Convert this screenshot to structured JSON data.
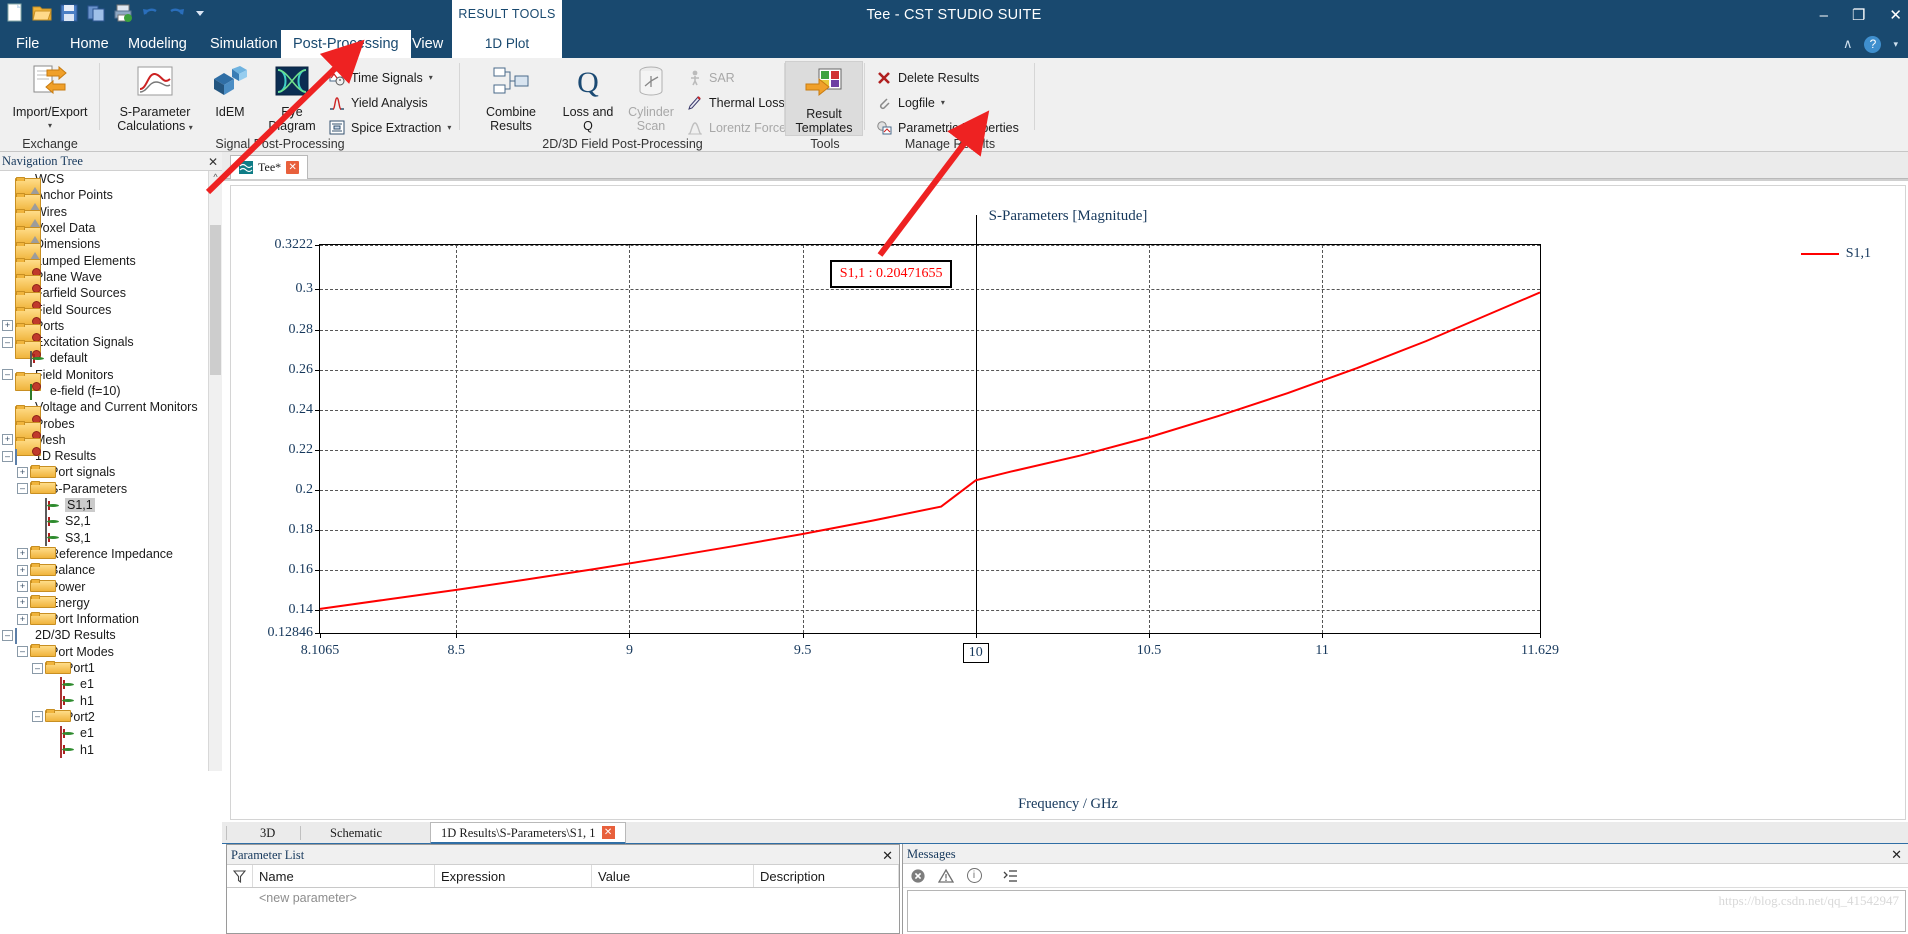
{
  "window": {
    "title": "Tee - CST STUDIO SUITE",
    "minimize": "–",
    "maximize": "❐",
    "close": "✕"
  },
  "quick_access": [
    "new-icon",
    "open-icon",
    "save-icon",
    "copy-icon",
    "print-icon",
    "undo-icon",
    "redo-icon",
    "customize-icon"
  ],
  "context_tab": {
    "line1": "RESULT TOOLS",
    "line2": "1D Plot"
  },
  "tabs": [
    {
      "label": "File",
      "active": false
    },
    {
      "label": "Home",
      "active": false
    },
    {
      "label": "Modeling",
      "active": false
    },
    {
      "label": "Simulation",
      "active": false
    },
    {
      "label": "Post-Processing",
      "active": true
    },
    {
      "label": "View",
      "active": false
    }
  ],
  "help": {
    "collapse": "∧",
    "question": "?",
    "caret": "▾"
  },
  "ribbon": {
    "groups": [
      {
        "label": "Exchange"
      },
      {
        "label": "Signal Post-Processing"
      },
      {
        "label": "2D/3D Field Post-Processing"
      },
      {
        "label": "Tools"
      },
      {
        "label": "Manage Results"
      }
    ],
    "big_buttons": [
      {
        "name": "import-export",
        "line1": "Import/Export",
        "line2": "",
        "caret": "▾",
        "icon": "import-export-icon"
      },
      {
        "name": "s-parameter-calculations",
        "line1": "S-Parameter",
        "line2": "Calculations",
        "caret": "▾",
        "icon": "s-parameter-icon"
      },
      {
        "name": "ideem",
        "line1": "IdEM",
        "line2": "",
        "caret": "",
        "icon": "idem-icon"
      },
      {
        "name": "eye-diagram",
        "line1": "Eye",
        "line2": "Diagram",
        "caret": "",
        "icon": "eye-diagram-icon"
      },
      {
        "name": "combine-results",
        "line1": "Combine",
        "line2": "Results",
        "caret": "",
        "icon": "combine-results-icon"
      },
      {
        "name": "loss-and-q",
        "line1": "Loss and",
        "line2": "Q",
        "caret": "",
        "icon": "loss-q-icon"
      },
      {
        "name": "cylinder-scan",
        "line1": "Cylinder",
        "line2": "Scan",
        "caret": "",
        "icon": "cylinder-scan-icon",
        "disabled": true
      },
      {
        "name": "result-templates",
        "line1": "Result",
        "line2": "Templates",
        "caret": "",
        "icon": "result-templates-icon",
        "pressed": true
      }
    ],
    "small_buttons": [
      {
        "name": "time-signals",
        "label": "Time Signals",
        "caret": "▾",
        "icon": "time-signals-icon",
        "disabled": false
      },
      {
        "name": "yield-analysis",
        "label": "Yield Analysis",
        "caret": "",
        "icon": "yield-analysis-icon",
        "disabled": false
      },
      {
        "name": "spice-extraction",
        "label": "Spice Extraction",
        "caret": "▾",
        "icon": "spice-extraction-icon",
        "disabled": false
      },
      {
        "name": "sar",
        "label": "SAR",
        "caret": "",
        "icon": "sar-icon",
        "disabled": true
      },
      {
        "name": "thermal-losses",
        "label": "Thermal Losses",
        "caret": "",
        "icon": "thermal-losses-icon",
        "disabled": false
      },
      {
        "name": "lorentz-forces",
        "label": "Lorentz Forces",
        "caret": "",
        "icon": "lorentz-forces-icon",
        "disabled": true
      },
      {
        "name": "delete-results",
        "label": "Delete Results",
        "caret": "",
        "icon": "delete-results-icon",
        "disabled": false
      },
      {
        "name": "logfile",
        "label": "Logfile",
        "caret": "▾",
        "icon": "logfile-icon",
        "disabled": false
      },
      {
        "name": "parametric-properties",
        "label": "Parametric Properties",
        "caret": "",
        "icon": "parametric-properties-icon",
        "disabled": false
      }
    ]
  },
  "navigation": {
    "header": "Navigation Tree",
    "close": "✕",
    "items": [
      {
        "label": "WCS",
        "indent": 1,
        "expander": "",
        "icon": "folder-shape-icon"
      },
      {
        "label": "Anchor Points",
        "indent": 1,
        "expander": "",
        "icon": "folder-shape-icon"
      },
      {
        "label": "Wires",
        "indent": 1,
        "expander": "",
        "icon": "folder-shape-icon"
      },
      {
        "label": "Voxel Data",
        "indent": 1,
        "expander": "",
        "icon": "folder-shape-icon"
      },
      {
        "label": "Dimensions",
        "indent": 1,
        "expander": "",
        "icon": "folder-shape-icon"
      },
      {
        "label": "Lumped Elements",
        "indent": 1,
        "expander": "",
        "icon": "folder-gear-icon"
      },
      {
        "label": "Plane Wave",
        "indent": 1,
        "expander": "",
        "icon": "folder-gear-icon"
      },
      {
        "label": "Farfield Sources",
        "indent": 1,
        "expander": "",
        "icon": "folder-gear-icon"
      },
      {
        "label": "Field Sources",
        "indent": 1,
        "expander": "",
        "icon": "folder-gear-icon"
      },
      {
        "label": "Ports",
        "indent": 1,
        "expander": "+",
        "icon": "folder-gear-icon"
      },
      {
        "label": "Excitation Signals",
        "indent": 1,
        "expander": "–",
        "icon": "folder-gear-icon"
      },
      {
        "label": "default",
        "indent": 2,
        "expander": "",
        "icon": "signal-icon"
      },
      {
        "label": "Field Monitors",
        "indent": 1,
        "expander": "–",
        "icon": "folder-gear-icon"
      },
      {
        "label": "e-field (f=10)",
        "indent": 2,
        "expander": "",
        "icon": "efield-icon"
      },
      {
        "label": "Voltage and Current Monitors",
        "indent": 1,
        "expander": "",
        "icon": "folder-gear-icon"
      },
      {
        "label": "Probes",
        "indent": 1,
        "expander": "",
        "icon": "folder-gear-icon"
      },
      {
        "label": "Mesh",
        "indent": 1,
        "expander": "+",
        "icon": "folder-gear-icon"
      },
      {
        "label": "1D Results",
        "indent": 1,
        "expander": "–",
        "icon": "results-1d-icon"
      },
      {
        "label": "Port signals",
        "indent": 2,
        "expander": "+",
        "icon": "folder-icon"
      },
      {
        "label": "S-Parameters",
        "indent": 2,
        "expander": "–",
        "icon": "folder-icon"
      },
      {
        "label": "S1,1",
        "indent": 3,
        "expander": "",
        "icon": "signal-icon",
        "selected": true
      },
      {
        "label": "S2,1",
        "indent": 3,
        "expander": "",
        "icon": "signal-icon"
      },
      {
        "label": "S3,1",
        "indent": 3,
        "expander": "",
        "icon": "signal-icon"
      },
      {
        "label": "Reference Impedance",
        "indent": 2,
        "expander": "+",
        "icon": "folder-icon"
      },
      {
        "label": "Balance",
        "indent": 2,
        "expander": "+",
        "icon": "folder-icon"
      },
      {
        "label": "Power",
        "indent": 2,
        "expander": "+",
        "icon": "folder-icon"
      },
      {
        "label": "Energy",
        "indent": 2,
        "expander": "+",
        "icon": "folder-icon"
      },
      {
        "label": "Port Information",
        "indent": 2,
        "expander": "+",
        "icon": "folder-icon"
      },
      {
        "label": "2D/3D Results",
        "indent": 1,
        "expander": "–",
        "icon": "results-1d-icon"
      },
      {
        "label": "Port Modes",
        "indent": 2,
        "expander": "–",
        "icon": "folder-icon"
      },
      {
        "label": "Port1",
        "indent": 3,
        "expander": "–",
        "icon": "folder-icon"
      },
      {
        "label": "e1",
        "indent": 4,
        "expander": "",
        "icon": "mode-icon"
      },
      {
        "label": "h1",
        "indent": 4,
        "expander": "",
        "icon": "mode-icon"
      },
      {
        "label": "Port2",
        "indent": 3,
        "expander": "–",
        "icon": "folder-icon"
      },
      {
        "label": "e1",
        "indent": 4,
        "expander": "",
        "icon": "mode-icon"
      },
      {
        "label": "h1",
        "indent": 4,
        "expander": "",
        "icon": "mode-icon"
      }
    ]
  },
  "document_tab": {
    "label": "Tee*",
    "close": "✕"
  },
  "chart_data": {
    "type": "line",
    "title": "S-Parameters [Magnitude]",
    "xlabel": "Frequency / GHz",
    "ylabel": "",
    "xlim": [
      8.1065,
      11.629
    ],
    "ylim": [
      0.12846,
      0.3222
    ],
    "grid": true,
    "legend_position": "right",
    "xticks": [
      "8.1065",
      "8.5",
      "9",
      "9.5",
      "10",
      "10.5",
      "11",
      "11.629"
    ],
    "xtick_values": [
      8.1065,
      8.5,
      9,
      9.5,
      10,
      10.5,
      11,
      11.629
    ],
    "yticks": [
      "0.3222",
      "0.3",
      "0.28",
      "0.26",
      "0.24",
      "0.22",
      "0.2",
      "0.18",
      "0.16",
      "0.14",
      "0.12846"
    ],
    "ytick_values": [
      0.3222,
      0.3,
      0.28,
      0.26,
      0.24,
      0.22,
      0.2,
      0.18,
      0.16,
      0.14,
      0.12846
    ],
    "series": [
      {
        "name": "S1,1",
        "color": "#ff0000",
        "x": [
          8.1065,
          8.3,
          8.5,
          8.7,
          8.9,
          9.1,
          9.3,
          9.5,
          9.7,
          9.9,
          10.0,
          10.1,
          10.3,
          10.5,
          10.7,
          10.9,
          11.1,
          11.3,
          11.5,
          11.629
        ],
        "values": [
          0.1405,
          0.1452,
          0.15,
          0.1551,
          0.1604,
          0.166,
          0.1718,
          0.1779,
          0.1845,
          0.1916,
          0.2047,
          0.209,
          0.217,
          0.2262,
          0.2368,
          0.2482,
          0.2607,
          0.2742,
          0.289,
          0.2985
        ]
      }
    ],
    "legend": [
      {
        "label": "S1,1",
        "color": "#ff0000"
      }
    ],
    "marker": {
      "label": "S1,1 : 0.20471655",
      "x_value": 10,
      "x_label": "10",
      "y_value": 0.20471655,
      "color": "#ff0000"
    }
  },
  "bottom_tabs": [
    {
      "label": "3D",
      "active": false
    },
    {
      "label": "Schematic",
      "active": false
    },
    {
      "label": "1D Results\\S-Parameters\\S1, 1",
      "active": true,
      "close": "✕"
    }
  ],
  "parameter_list": {
    "header": "Parameter List",
    "close": "✕",
    "columns": [
      "Name",
      "Expression",
      "Value",
      "Description"
    ],
    "rows": [
      {
        "name": "<new parameter>",
        "expression": "",
        "value": "",
        "description": ""
      }
    ],
    "filter_icon": "filter-icon"
  },
  "messages": {
    "header": "Messages",
    "close": "✕",
    "tools": [
      "errors-icon",
      "warnings-icon",
      "info-icon",
      "list-icon"
    ],
    "body": "",
    "watermark": "https://blog.csdn.net/qq_41542947"
  }
}
